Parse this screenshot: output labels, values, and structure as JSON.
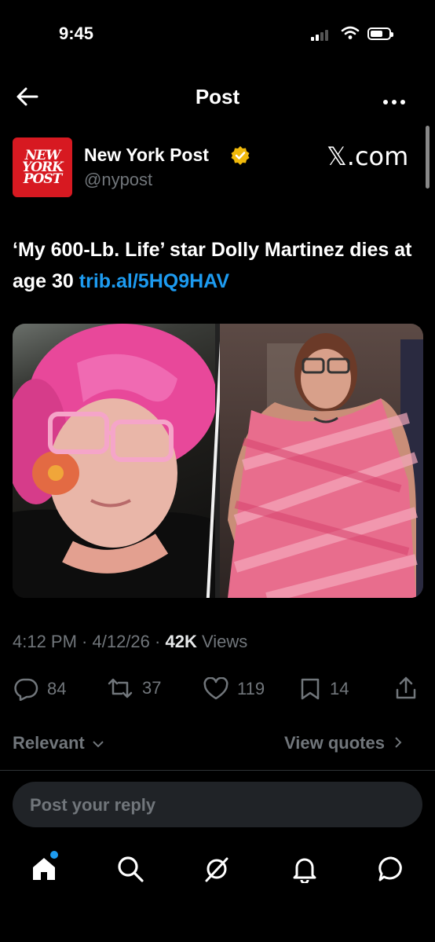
{
  "status_bar": {
    "time": "9:45",
    "battery_level": 0.7
  },
  "header": {
    "title": "Post"
  },
  "author": {
    "logo_text": [
      "NEW",
      "YORK",
      "POST"
    ],
    "name": "New York Post",
    "handle": "@nypost",
    "source_label": "𝕏.com"
  },
  "post": {
    "text": "‘My 600-Lb. Life’ star Dolly Martinez dies at age 30",
    "link": "trib.al/5HQ9HAV"
  },
  "meta": {
    "time": "4:12 PM",
    "sep1": " · ",
    "date": "4/12/26",
    "sep2": " · ",
    "views_count": "42K",
    "views_label": " Views"
  },
  "actions": {
    "replies": "84",
    "reposts": "37",
    "likes": "119",
    "bookmarks": "14"
  },
  "sort": {
    "relevant": "Relevant",
    "view_quotes": "View quotes"
  },
  "reply_box": {
    "placeholder": "Post your reply"
  },
  "colors": {
    "accent": "#1d9bf0",
    "verified": "#f0b90b",
    "brand_red": "#d71921"
  },
  "bottom_nav": [
    "home-icon",
    "search-icon",
    "grok-icon",
    "notifications-icon",
    "messages-icon"
  ]
}
